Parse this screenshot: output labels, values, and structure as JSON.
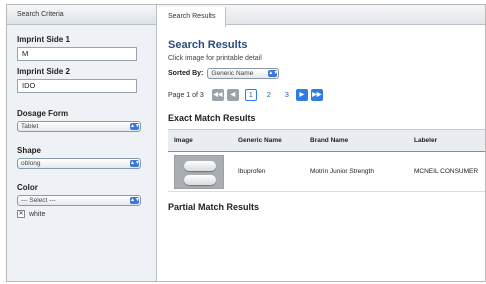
{
  "sidebar": {
    "tab_label": "Search Criteria",
    "imprint1": {
      "label": "Imprint Side 1",
      "value": "M"
    },
    "imprint2": {
      "label": "Imprint Side 2",
      "value": "IDO"
    },
    "dosage": {
      "label": "Dosage Form",
      "selected": "Tablet"
    },
    "shape": {
      "label": "Shape",
      "selected": "oblong"
    },
    "color": {
      "label": "Color",
      "selected": "--- Select ---"
    },
    "checkbox": {
      "label": "white",
      "checked": true
    }
  },
  "main": {
    "tab_label": "Search Results",
    "title": "Search Results",
    "hint": "Click image for printable detail",
    "sorted_by": {
      "label": "Sorted By:",
      "selected": "Generic Name"
    },
    "pager": {
      "info": "Page 1 of 3",
      "first": "◀◀",
      "prev": "◀",
      "pages": [
        "1",
        "2",
        "3"
      ],
      "current": "1",
      "next": "▶",
      "last": "▶▶"
    },
    "exact_title": "Exact Match Results",
    "table": {
      "headers": [
        "Image",
        "Generic Name",
        "Brand Name",
        "Labeler"
      ],
      "rows": [
        {
          "generic": "Ibuprofen",
          "brand": "Motrin Junior Strength",
          "labeler": "MCNEIL CONSUMER"
        }
      ]
    },
    "partial_title": "Partial Match Results"
  },
  "colors": {
    "accent": "#2f7de1",
    "title": "#2a4f7f",
    "sidebar_bg": "#eef1f5"
  }
}
